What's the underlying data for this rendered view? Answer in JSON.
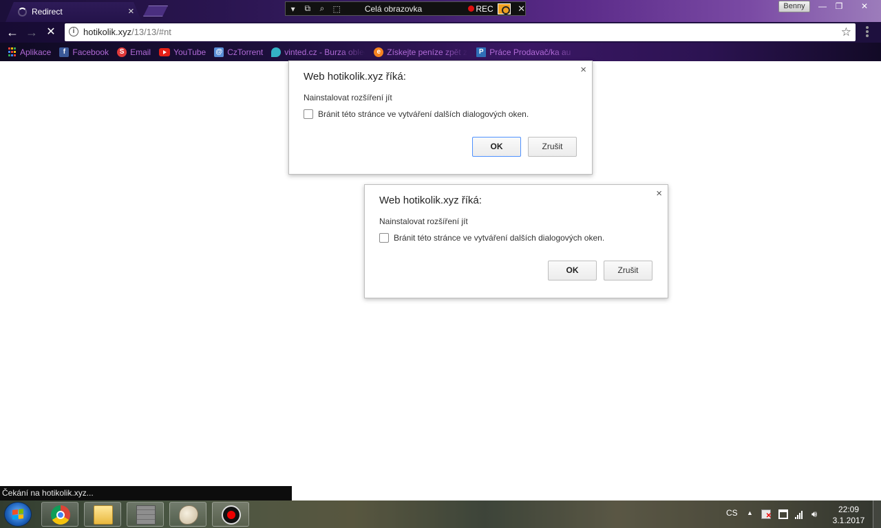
{
  "window": {
    "tab_title": "Redirect",
    "tab_close": "×",
    "user_button": "Benny",
    "minimize": "—",
    "maximize": "❐",
    "close": "✕"
  },
  "recorder_toolbar": {
    "mode_label": "Celá obrazovka",
    "rec_label": "REC",
    "close": "✕"
  },
  "omnibox": {
    "url_host": "hotikolik.xyz",
    "url_path": "/13/13/#nt",
    "info_icon": "i"
  },
  "bookmarks": [
    {
      "label": "Aplikace",
      "icon": "apps-icon"
    },
    {
      "label": "Facebook",
      "icon": "facebook-icon"
    },
    {
      "label": "Email",
      "icon": "email-icon"
    },
    {
      "label": "YouTube",
      "icon": "youtube-icon"
    },
    {
      "label": "CzTorrent",
      "icon": "cztorrent-icon"
    },
    {
      "label": "vinted.cz - Burza oblec",
      "icon": "vinted-icon"
    },
    {
      "label": "Získejte peníze zpět z",
      "icon": "cashback-icon"
    },
    {
      "label": "Práce Prodavač/ka au",
      "icon": "prace-icon"
    }
  ],
  "dialogs": [
    {
      "title": "Web hotikolik.xyz říká:",
      "message": "Nainstalovat rozšíření jít",
      "checkbox_label": "Bránit této stránce ve vytváření dalších dialogových oken.",
      "ok": "OK",
      "cancel": "Zrušit",
      "close": "×"
    },
    {
      "title": "Web hotikolik.xyz říká:",
      "message": "Nainstalovat rozšíření jít",
      "checkbox_label": "Bránit této stránce ve vytváření dalších dialogových oken.",
      "ok": "OK",
      "cancel": "Zrušit",
      "close": "×"
    }
  ],
  "status_text": "Čekání na hotikolik.xyz...",
  "taskbar": {
    "language": "CS",
    "time": "22:09",
    "date": "3.1.2017",
    "apps": [
      "chrome-icon",
      "file-explorer-icon",
      "firewall-icon",
      "paint-icon",
      "recorder-icon"
    ]
  },
  "colors": {
    "bookmark_text": "#b06ad6",
    "ok_focus": "#4d90fe",
    "theme_purple": "#3a1d66"
  }
}
